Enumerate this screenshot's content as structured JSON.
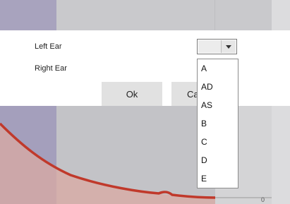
{
  "dialog": {
    "left_ear_label": "Left Ear",
    "right_ear_label": "Right Ear",
    "ok_label": "Ok",
    "cancel_label_visible": "Ca"
  },
  "combo": {
    "selected_value": "",
    "options": [
      "A",
      "AD",
      "AS",
      "B",
      "C",
      "D",
      "E"
    ]
  },
  "chart": {
    "axis_zero_label": "0",
    "line_color": "#c0392b",
    "fill_color": "#e8b8b0"
  }
}
